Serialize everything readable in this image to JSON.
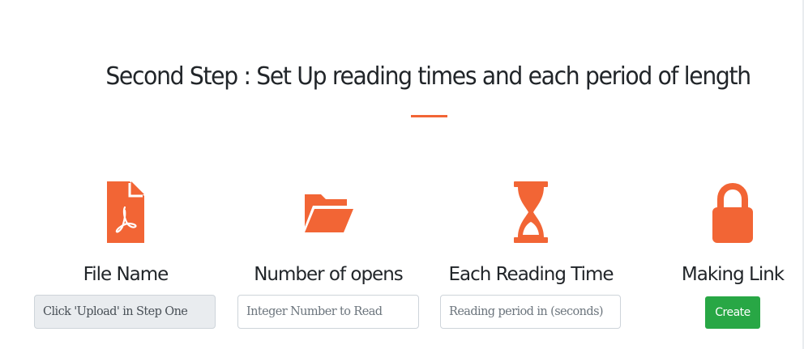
{
  "header": {
    "title": "Second Step : Set Up reading times and each period of length"
  },
  "accent_color": "#f26535",
  "columns": [
    {
      "icon": "pdf-file-icon",
      "label": "File Name",
      "field": {
        "value": "Click 'Upload' in Step One",
        "readonly": true
      }
    },
    {
      "icon": "folder-open-icon",
      "label": "Number of opens",
      "field": {
        "placeholder": "Integer Number to Read",
        "value": ""
      }
    },
    {
      "icon": "hourglass-icon",
      "label": "Each Reading Time",
      "field": {
        "placeholder": "Reading period in (seconds)",
        "value": ""
      }
    },
    {
      "icon": "lock-icon",
      "label": "Making Link",
      "button": {
        "label": "Create",
        "color": "#28a745"
      }
    }
  ]
}
